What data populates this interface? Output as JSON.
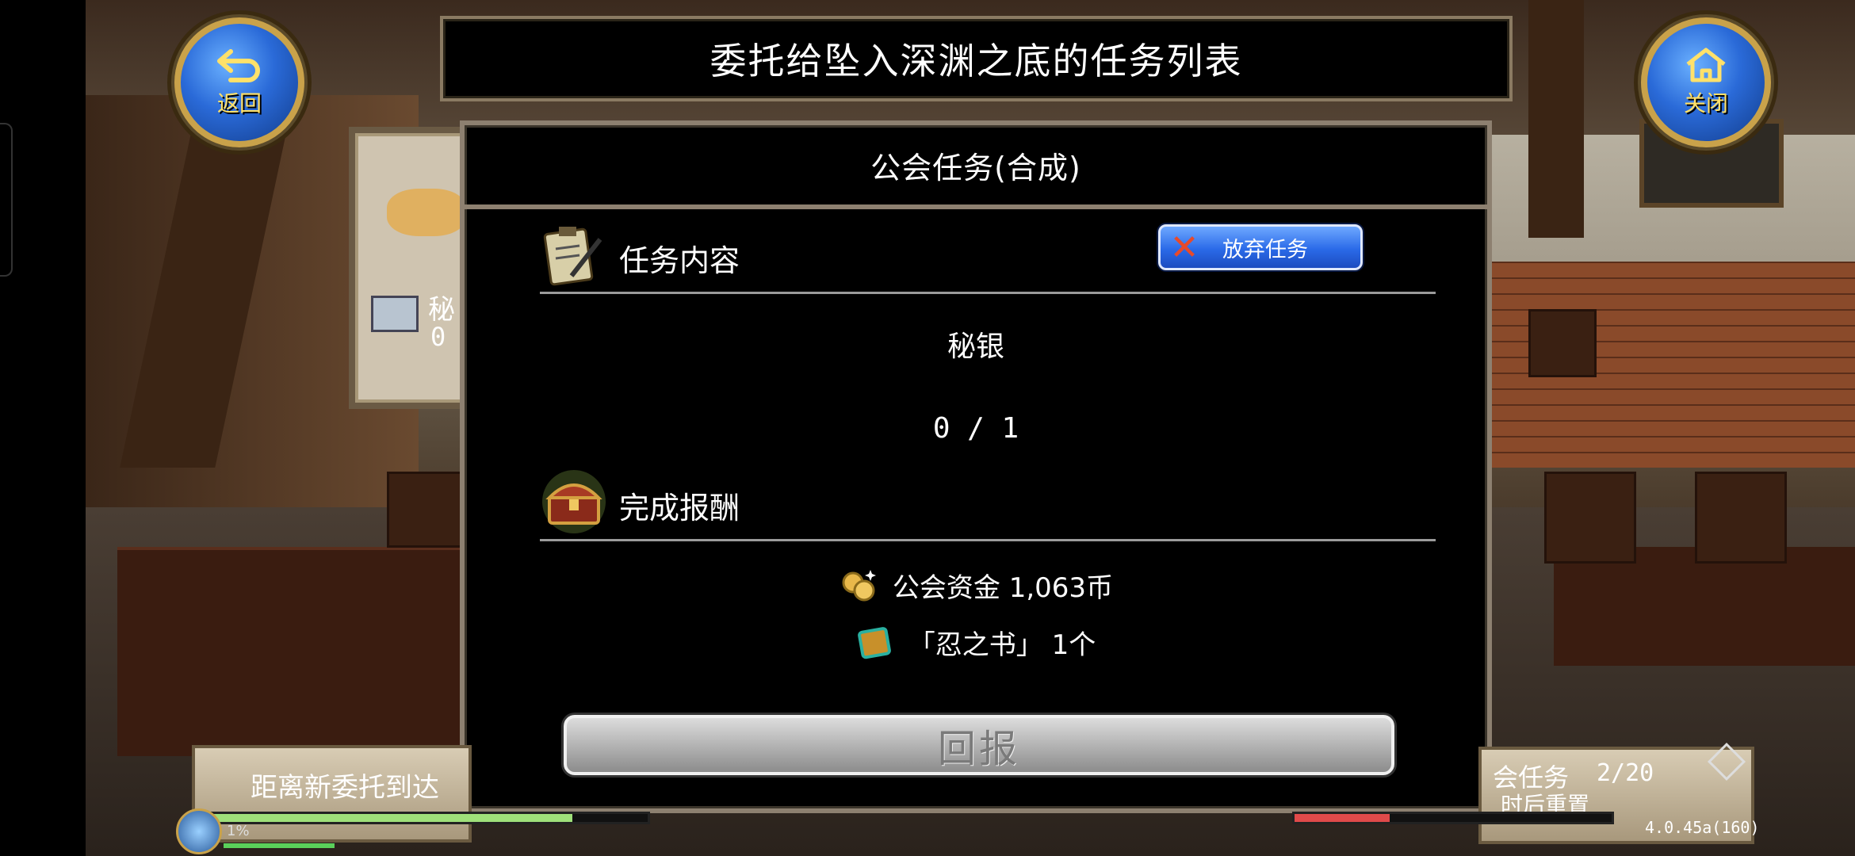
{
  "title": "委托给坠入深渊之底的任务列表",
  "back_button": {
    "label": "返回"
  },
  "close_button": {
    "label": "关闭"
  },
  "side_card": {
    "item_name": "秘",
    "progress": "0 /"
  },
  "dialog": {
    "header": "公会任务(合成)",
    "task_section_label": "任务内容",
    "abandon_button": "放弃任务",
    "task_item": "秘银",
    "task_progress": "0 / 1",
    "reward_section_label": "完成报酬",
    "rewards": [
      {
        "icon": "coins-icon",
        "text": "公会资金 1,063币"
      },
      {
        "icon": "book-icon",
        "text": "「忍之书」 1个"
      }
    ],
    "report_button": "回报"
  },
  "bottom_left": {
    "text": "距离新委托到达",
    "level_text": "1%",
    "bar_fill": 0.83
  },
  "bottom_right": {
    "tasks_label": "会任务",
    "tasks_count": "2/20",
    "reset_text": "时后重置",
    "bar_fill": 0.3
  },
  "version": "4.0.45a(160)",
  "colors": {
    "accent_blue": "#2a6ae8",
    "gold": "#c9a24a",
    "abandon_x": "#e84a2a"
  }
}
